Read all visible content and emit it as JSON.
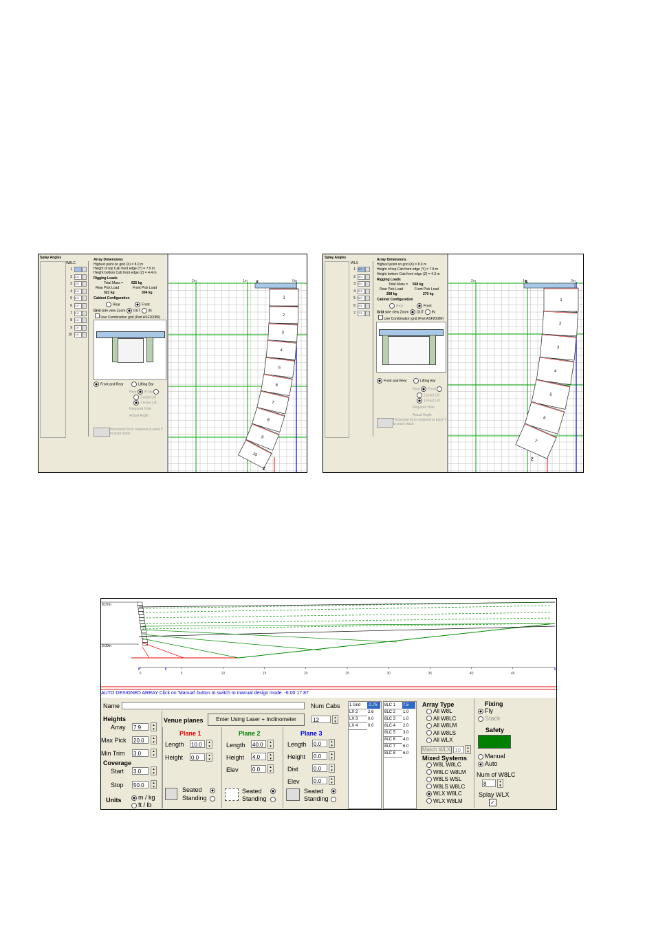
{
  "screenshot_left": {
    "panel_title": "Splay Angles",
    "cabinet_type": "W8LC",
    "rows": [
      {
        "n": "1",
        "v": ""
      },
      {
        "n": "2",
        "v": "2.0"
      },
      {
        "n": "3",
        "v": "2.0"
      },
      {
        "n": "4",
        "v": "2.0"
      },
      {
        "n": "5",
        "v": "2.0"
      },
      {
        "n": "6",
        "v": "2.0"
      },
      {
        "n": "7",
        "v": "2.0"
      },
      {
        "n": "8",
        "v": "1.0"
      },
      {
        "n": "9",
        "v": "1.0"
      },
      {
        "n": "10",
        "v": "1.0"
      }
    ],
    "array_dimensions_title": "Array Dimensions",
    "dim1": "Highest point on grid (X) = 8.0 m",
    "dim2": "Height of top Cab front edge (Y) = 7.9 m",
    "dim3": "Height bottom Cab front edge (Z) = 4.4 m",
    "rigging_title": "Rigging Loads",
    "total_mass_label": "Total Mass =",
    "total_mass": "625 kg",
    "rear_label": "Rear Pick Load",
    "front_label": "Front Pick Load",
    "rear_value": "321 kg",
    "front_value": "304 kg",
    "cabinet_config_title": "Cabinet Configuration",
    "rear_radio": "Rear",
    "front_radio": "Front",
    "grid_label": "Grid",
    "side_view_zoom": "side view Zoom",
    "out_label": "OUT",
    "in_label": "IN",
    "combination_grid": "Use Combination grid (Part ASF20080)",
    "front_and_rear": "Front and Rear",
    "lifting_bar": "Lifting Bar",
    "rear_label2": "Rear",
    "front_label2": "Front",
    "two_point_lift": "2 point Lift",
    "one_point_lift": "1 Point Lift",
    "required_hole": "Required Hole",
    "actual_angle": "Actual Angle",
    "horizontal_force": "Horizontal force required at point Y to push stack",
    "cabinets": [
      "1",
      "2",
      "3",
      "4",
      "5",
      "6",
      "7",
      "8",
      "9",
      "10"
    ],
    "grid_labels": [
      "2m",
      "1m",
      "0m"
    ],
    "marker_x": "X",
    "marker_y": "Y",
    "marker_z": "Z"
  },
  "screenshot_right": {
    "panel_title": "Splay Angles",
    "cabinet_type": "WLX",
    "rows": [
      {
        "n": "1",
        "v": "0.0"
      },
      {
        "n": "2",
        "v": "5.0"
      },
      {
        "n": "3",
        "v": "0.0"
      },
      {
        "n": "4",
        "v": "2.5"
      },
      {
        "n": "5",
        "v": "5.0"
      },
      {
        "n": "6",
        "v": "2.5"
      },
      {
        "n": "7",
        "v": "7.5"
      }
    ],
    "array_dimensions_title": "Array Dimensions",
    "dim1": "Highest point on grid (X) = 8.0 m",
    "dim2": "Height of top Cab front edge (Y) = 7.8 m",
    "dim3": "Height bottom Cab front edge (Z) = 4.3 m",
    "rigging_title": "Rigging Loads",
    "total_mass_label": "Total Mass =",
    "total_mass": "568 kg",
    "rear_label": "Rear Pick Load",
    "front_label": "Front Pick Load",
    "rear_value": "298 kg",
    "front_value": "270 kg",
    "cabinet_config_title": "Cabinet Configuration",
    "rear_radio": "Rear",
    "front_radio": "Front",
    "grid_label": "Grid",
    "side_view_zoom": "side view Zoom",
    "out_label": "OUT",
    "in_label": "IN",
    "combination_grid": "Use Combination grid (Part ASF20080)",
    "front_and_rear": "Front and Rear",
    "lifting_bar": "Lifting Bar",
    "rear_label2": "Rear",
    "front_label2": "Front",
    "two_point_lift": "2 point Lift",
    "one_point_lift": "1 Point Lift",
    "required_hole": "Required Hole",
    "actual_angle": "Actual Angle",
    "horizontal_force": "Horizontal force required at point Y to push stack",
    "cabinets": [
      "1",
      "2",
      "3",
      "4",
      "5",
      "6",
      "7"
    ],
    "grid_labels": [
      "2m",
      "1m",
      "0m"
    ],
    "marker_x": "X",
    "marker_y": "Y",
    "marker_z": "Z"
  },
  "app": {
    "plot_label_top": "8.07m",
    "plot_label_mid": "3.09m",
    "x_ticks": [
      "0",
      "5",
      "10",
      "15",
      "20",
      "25",
      "30",
      "35",
      "40",
      "45"
    ],
    "status": "AUTO DESIGNED ARRAY  Click on 'Manual' button to switch to manual design mode.   -6.00  17.87",
    "name_label": "Name",
    "name_value": "",
    "num_cabs_label": "Num Cabs",
    "num_cabs": "12",
    "heights_title": "Heights",
    "array_label": "Array",
    "array_value": "7.9",
    "max_pick_label": "Max Pick",
    "max_pick_value": "20.0",
    "min_trim_label": "Min Trim",
    "min_trim_value": "3.0",
    "coverage_title": "Coverage",
    "start_label": "Start",
    "start_value": "3.0",
    "stop_label": "Stop",
    "stop_value": "50.0",
    "units_title": "Units",
    "units_mkg": "m / kg",
    "units_ftlb": "ft / lb",
    "venue_planes": "Venue planes",
    "enter_laser": "Enter Using Laser + Inclinometer",
    "plane1": {
      "title": "Plane 1",
      "length_label": "Length",
      "length": "10.0",
      "height_label": "Height",
      "height": "0.0",
      "seated": "Seated",
      "standing": "Standing"
    },
    "plane2": {
      "title": "Plane 2",
      "length_label": "Length",
      "length": "40.0",
      "height_label": "Height",
      "height": "4.0",
      "elev_label": "Elev",
      "elev": "0.0",
      "seated": "Seated",
      "standing": "Standing"
    },
    "plane3": {
      "title": "Plane 3",
      "length_label": "Length",
      "length": "0.0",
      "height_label": "Height",
      "height": "0.0",
      "dist_label": "Dist",
      "dist": "0.0",
      "elev_label": "Elev",
      "elev": "0.0",
      "seated": "Seated",
      "standing": "Standing"
    },
    "table1": [
      [
        "1 Grid",
        "-2.75"
      ],
      [
        "LX 2",
        "2.6"
      ],
      [
        "LX 3",
        "0.0"
      ],
      [
        "LX 4",
        "0.0"
      ]
    ],
    "table2": [
      [
        "8LC 1",
        "7.5"
      ],
      [
        "8LC 2",
        "1.0"
      ],
      [
        "8LC 3",
        "1.0"
      ],
      [
        "8LC 4",
        "2.0"
      ],
      [
        "8LC 5",
        "3.0"
      ],
      [
        "8LC 6",
        "4.0"
      ],
      [
        "8LC 7",
        "6.0"
      ],
      [
        "8LC 8",
        "6.0"
      ]
    ],
    "array_type_title": "Array Type",
    "array_types": [
      "All W8L",
      "All W8LC",
      "All W8LM",
      "All W8LS",
      "All WLX"
    ],
    "match_wlx": "Match WLX",
    "match_value": "10",
    "mixed_title": "Mixed Systems",
    "mixed": [
      "W8L W8LC",
      "W8LC W8LM",
      "W8LS WSL",
      "W8LS W8LC",
      "WLX W8LC",
      "WLX W8LM"
    ],
    "fixing_title": "Fixing",
    "fly": "Fly",
    "stack": "Stack",
    "safety_title": "Safety",
    "safety_color": "#008000",
    "manual": "Manual",
    "auto": "Auto",
    "num_w8lc_label": "Num of W8LC",
    "num_w8lc": "8",
    "splay_wlx": "Splay WLX",
    "checkmark": "✓"
  }
}
